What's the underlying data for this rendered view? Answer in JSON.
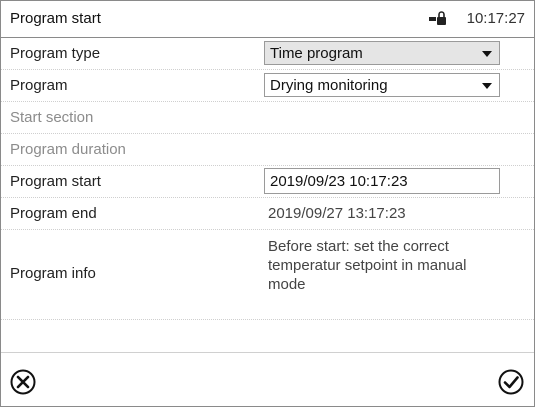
{
  "header": {
    "title": "Program start",
    "time": "10:17:27",
    "lock_icon": "door-lock-icon"
  },
  "rows": {
    "program_type": {
      "label": "Program type",
      "value": "Time program"
    },
    "program": {
      "label": "Program",
      "value": "Drying monitoring"
    },
    "start_section": {
      "label": "Start section"
    },
    "program_duration": {
      "label": "Program duration"
    },
    "program_start": {
      "label": "Program start",
      "value": "2019/09/23 10:17:23"
    },
    "program_end": {
      "label": "Program end",
      "value": "2019/09/27 13:17:23"
    },
    "program_info": {
      "label": "Program info",
      "value_lines": [
        "Before start: set the correct",
        "temperatur setpoint in manual",
        "mode"
      ]
    }
  },
  "footer": {
    "cancel_icon": "cancel-circle-x-icon",
    "confirm_icon": "confirm-circle-check-icon"
  }
}
